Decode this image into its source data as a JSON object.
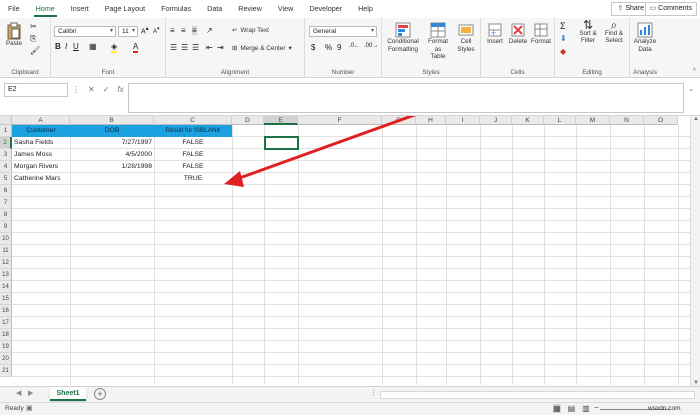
{
  "menu": {
    "items": [
      "File",
      "Home",
      "Insert",
      "Page Layout",
      "Formulas",
      "Data",
      "Review",
      "View",
      "Developer",
      "Help"
    ],
    "active_index": 1,
    "share_label": "Share",
    "comments_label": "Comments"
  },
  "ribbon": {
    "clipboard": {
      "paste": "Paste",
      "label": "Clipboard"
    },
    "font": {
      "name": "Calibri",
      "size": "11",
      "label": "Font"
    },
    "alignment": {
      "wrap": "Wrap Text",
      "merge": "Merge & Center",
      "label": "Alignment"
    },
    "number": {
      "format": "General",
      "label": "Number",
      "dollar": "$",
      "percent": "%",
      "comma": "9"
    },
    "styles": {
      "conditional": "Conditional",
      "conditional2": "Formatting",
      "format_as": "Format as",
      "format_as2": "Table",
      "cell": "Cell",
      "cell2": "Styles",
      "label": "Styles"
    },
    "cells": {
      "insert": "Insert",
      "delete": "Delete",
      "format": "Format",
      "label": "Cells"
    },
    "editing": {
      "sort": "Sort &",
      "sort2": "Filter",
      "find": "Find &",
      "find2": "Select",
      "label": "Editing"
    },
    "analysis": {
      "analyze": "Analyze",
      "analyze2": "Data",
      "label": "Analysis"
    }
  },
  "formula_bar": {
    "name_box": "E2",
    "fx": "fx",
    "value": ""
  },
  "grid": {
    "columns": [
      "A",
      "B",
      "C",
      "D",
      "E",
      "F",
      "G",
      "H",
      "I",
      "J",
      "K",
      "L",
      "M",
      "N",
      "O"
    ],
    "selected_column": "E",
    "selected_row": "2",
    "rows": [
      "1",
      "2",
      "3",
      "4",
      "5",
      "6",
      "7",
      "8",
      "9",
      "10",
      "11",
      "12",
      "13",
      "14",
      "15",
      "16",
      "17",
      "18",
      "19",
      "20",
      "21"
    ],
    "headers": {
      "customer": "Customer",
      "dob": "DOB",
      "result": "Result for ISBLANK"
    },
    "data": [
      {
        "customer": "Sasha Fields",
        "dob": "7/27/1997",
        "result": "FALSE"
      },
      {
        "customer": "James Moss",
        "dob": "4/5/2000",
        "result": "FALSE"
      },
      {
        "customer": "Morgan  Rivers",
        "dob": "1/28/1998",
        "result": "FALSE"
      },
      {
        "customer": "Catherine Mars",
        "dob": "",
        "result": "TRUE"
      }
    ],
    "header_fill": "#1aa1e0",
    "arrow_color": "#e02020"
  },
  "sheets": {
    "active": "Sheet1"
  },
  "status": {
    "ready": "Ready"
  },
  "watermark": "wsxdn.com"
}
